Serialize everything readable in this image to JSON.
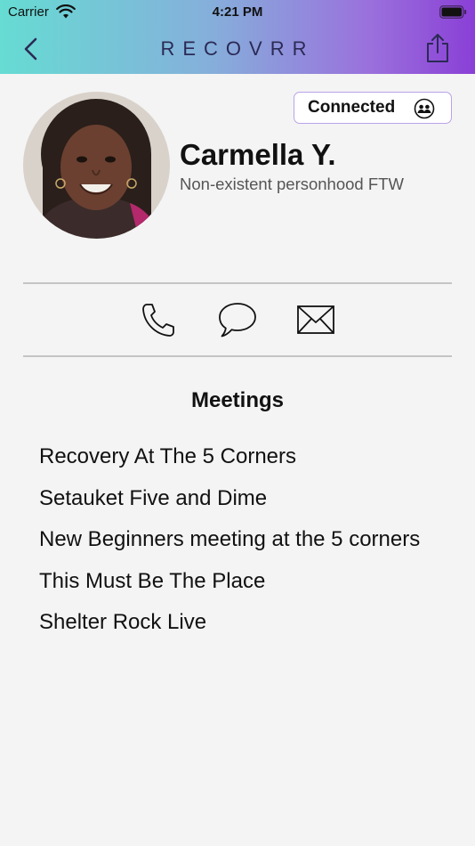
{
  "status_bar": {
    "carrier": "Carrier",
    "time": "4:21 PM",
    "wifi_icon": "wifi-icon",
    "battery_icon": "battery-icon"
  },
  "nav": {
    "back_icon": "chevron-left-icon",
    "brand": "RECOVRR",
    "share_icon": "share-icon",
    "gradient_colors": [
      "#66dcd3",
      "#86aedb",
      "#9a70dc",
      "#8a3fd6"
    ]
  },
  "profile": {
    "avatar_icon": "profile-photo",
    "connection_status": "Connected",
    "connection_icon": "people-icon",
    "name": "Carmella Y.",
    "tagline": "Non-existent personhood FTW"
  },
  "actions": [
    {
      "id": "call",
      "icon": "phone-icon"
    },
    {
      "id": "message",
      "icon": "chat-bubble-icon"
    },
    {
      "id": "email",
      "icon": "envelope-icon"
    }
  ],
  "meetings": {
    "title": "Meetings",
    "items": [
      "Recovery At The 5 Corners",
      "Setauket Five and Dime",
      "New Beginners meeting at the 5 corners",
      "This Must Be The Place",
      "Shelter Rock Live"
    ]
  },
  "colors": {
    "background": "#f4f4f4",
    "badge_border": "#b9a2ea",
    "brand_text": "#2b2a55"
  }
}
